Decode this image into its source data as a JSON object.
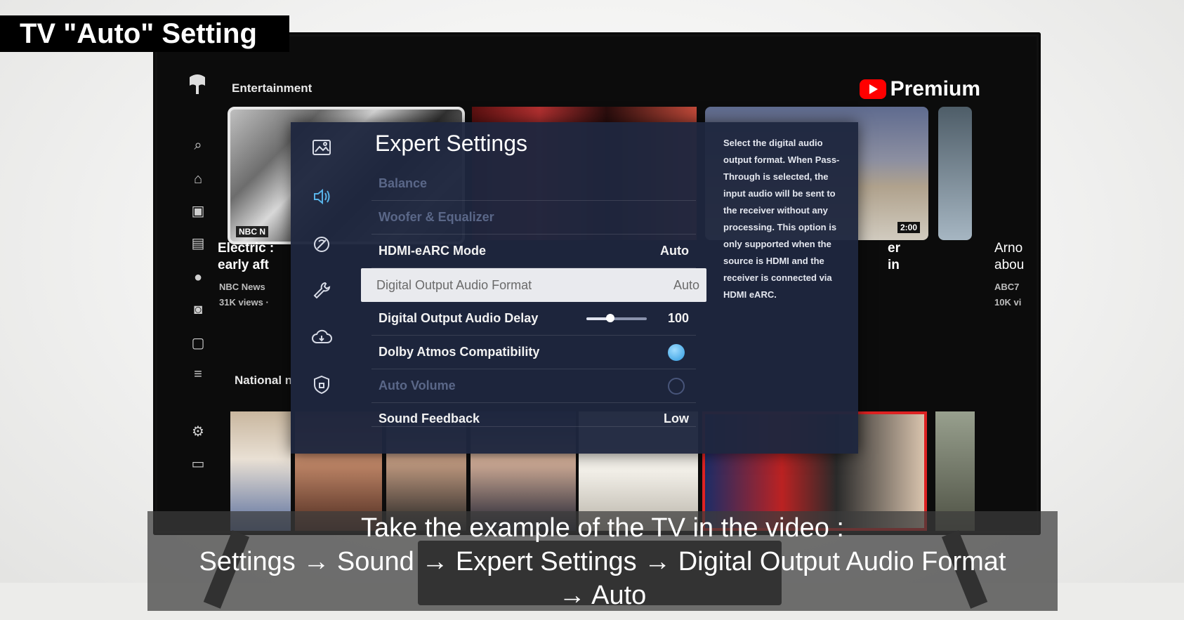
{
  "overlay_title": "TV \"Auto\" Setting",
  "youtube": {
    "section_label": "Entertainment",
    "section_label_2": "National n",
    "premium_label": "Premium",
    "cards": [
      {
        "title_line1": "Electric :",
        "title_line2": "early aft",
        "channel": "NBC News",
        "meta": "31K views ·"
      },
      {
        "title_line1": "er",
        "title_line2": "in",
        "channel": "",
        "meta": ""
      },
      {
        "title_line1": "Arno",
        "title_line2": "abou",
        "channel": "ABC7",
        "meta": "10K vi"
      }
    ],
    "thumb_badges": {
      "nbc": "NBC N",
      "duration": "2:00"
    }
  },
  "settings": {
    "title": "Expert Settings",
    "help_text": "Select the digital audio output format. When Pass-Through is selected, the input audio will be sent to the receiver without any processing. This option is only supported when the source is HDMI and the receiver is connected via HDMI eARC.",
    "items": [
      {
        "label": "Balance",
        "value": "",
        "state": "disabled"
      },
      {
        "label": "Woofer & Equalizer",
        "value": "",
        "state": "disabled"
      },
      {
        "label": "HDMI-eARC Mode",
        "value": "Auto",
        "state": "normal"
      },
      {
        "label": "Digital Output Audio Format",
        "value": "Auto",
        "state": "focused"
      },
      {
        "label": "Digital Output Audio Delay",
        "value": "100",
        "state": "normal",
        "slider_fraction": 0.4
      },
      {
        "label": "Dolby Atmos Compatibility",
        "value": "",
        "state": "normal",
        "toggle": "on"
      },
      {
        "label": "Auto Volume",
        "value": "",
        "state": "disabled",
        "toggle": "off"
      },
      {
        "label": "Sound Feedback",
        "value": "Low",
        "state": "normal"
      }
    ],
    "rail_icons": [
      "picture-icon",
      "sound-icon",
      "broadcast-icon",
      "support-icon",
      "cloud-update-icon",
      "privacy-shield-icon"
    ],
    "active_rail": "sound-icon",
    "accent_color": "#58b3e8"
  },
  "caption": {
    "line1": "Take the example of the TV in the video :",
    "line2": "Settings → Sound → Expert Settings → Digital Output Audio Format",
    "line3": "→ Auto"
  }
}
